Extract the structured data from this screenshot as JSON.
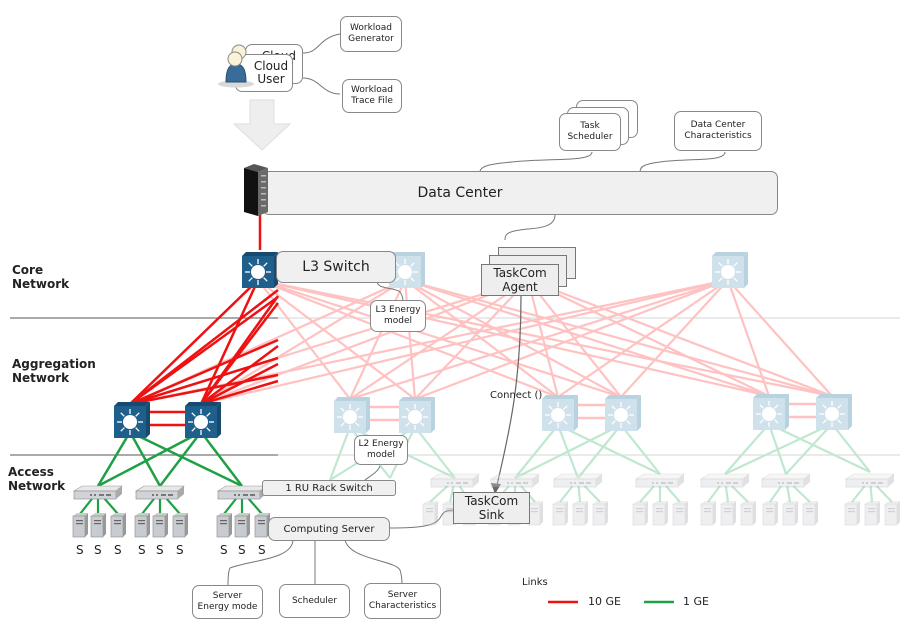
{
  "user": {
    "back_label": "Cloud",
    "label_line1": "Cloud",
    "label_line2": "User"
  },
  "workload": {
    "generator_line1": "Workload",
    "generator_line2": "Generator",
    "trace_line1": "Workload",
    "trace_line2": "Trace File"
  },
  "task_scheduler": {
    "line1": "Task",
    "line2": "Scheduler"
  },
  "dc_characteristics": {
    "line1": "Data Center",
    "line2": "Characteristics"
  },
  "data_center": {
    "label": "Data Center"
  },
  "sections": {
    "core_line1": "Core",
    "core_line2": "Network",
    "aggregation_line1": "Aggregation",
    "aggregation_line2": "Network",
    "access_line1": "Access",
    "access_line2": "Network"
  },
  "l3_switch": {
    "label": "L3 Switch"
  },
  "l3_energy": {
    "line1": "L3 Energy",
    "line2": "model"
  },
  "taskcom_agent": {
    "line1": "TaskCom",
    "line2": "Agent"
  },
  "connect": {
    "label": "Connect ()"
  },
  "l2_energy": {
    "line1": "L2 Energy",
    "line2": "model"
  },
  "rack_switch": {
    "label": "1 RU Rack Switch"
  },
  "computing_server": {
    "label": "Computing Server"
  },
  "taskcom_sink": {
    "line1": "TaskCom",
    "line2": "Sink"
  },
  "server_labels": [
    "S",
    "S",
    "S",
    "S",
    "S",
    "S",
    "S",
    "S",
    "S"
  ],
  "server_details": {
    "energy_line1": "Server",
    "energy_line2": "Energy mode",
    "scheduler": "Scheduler",
    "characteristics_line1": "Server",
    "characteristics_line2": "Characteristics"
  },
  "legend": {
    "title": "Links",
    "items": [
      {
        "label": "10 GE",
        "color": "#ee1111"
      },
      {
        "label": "1 GE",
        "color": "#1fa045"
      }
    ]
  },
  "colors": {
    "link_10ge": "#ee1111",
    "link_10ge_faded": "#ffc2c2",
    "link_1ge": "#1fa045",
    "link_1ge_faded": "#bfe8cf",
    "switch_active": "#1e5f8c",
    "switch_faded": "#cfe2ec"
  }
}
